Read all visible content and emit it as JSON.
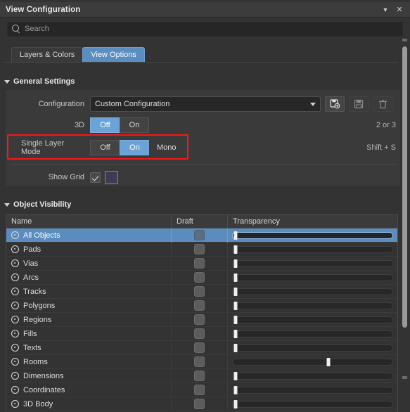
{
  "window": {
    "title": "View Configuration",
    "menu_icon": "chevron-down-icon",
    "close_icon": "close-icon"
  },
  "search": {
    "placeholder": "Search",
    "value": "",
    "icon": "search-icon"
  },
  "tabs": [
    {
      "label": "Layers & Colors",
      "active": false
    },
    {
      "label": "View Options",
      "active": true
    }
  ],
  "general_settings": {
    "header": "General Settings",
    "configuration": {
      "label": "Configuration",
      "value": "Custom Configuration",
      "buttons": [
        {
          "name": "add-configuration-button",
          "icon": "save-as-new-icon",
          "enabled": true
        },
        {
          "name": "save-configuration-button",
          "icon": "save-icon",
          "enabled": false
        },
        {
          "name": "delete-configuration-button",
          "icon": "trash-icon",
          "enabled": false
        }
      ]
    },
    "three_d": {
      "label": "3D",
      "options": [
        "Off",
        "On"
      ],
      "selected": "Off",
      "shortcut": "2 or 3"
    },
    "single_layer_mode": {
      "label": "Single Layer Mode",
      "options": [
        "Off",
        "On",
        "Mono"
      ],
      "selected": "On",
      "shortcut": "Shift + S",
      "highlighted": true
    },
    "show_grid": {
      "label": "Show Grid",
      "checked": true,
      "color": "#3f3a55"
    }
  },
  "object_visibility": {
    "header": "Object Visibility",
    "columns": [
      "Name",
      "Draft",
      "Transparency"
    ],
    "rows": [
      {
        "name": "All Objects",
        "visible": true,
        "draft": false,
        "transparency": 2,
        "selected": true
      },
      {
        "name": "Pads",
        "visible": true,
        "draft": false,
        "transparency": 2,
        "selected": false
      },
      {
        "name": "Vias",
        "visible": true,
        "draft": false,
        "transparency": 2,
        "selected": false
      },
      {
        "name": "Arcs",
        "visible": true,
        "draft": false,
        "transparency": 2,
        "selected": false
      },
      {
        "name": "Tracks",
        "visible": true,
        "draft": false,
        "transparency": 2,
        "selected": false
      },
      {
        "name": "Polygons",
        "visible": true,
        "draft": false,
        "transparency": 2,
        "selected": false
      },
      {
        "name": "Regions",
        "visible": true,
        "draft": false,
        "transparency": 2,
        "selected": false
      },
      {
        "name": "Fills",
        "visible": true,
        "draft": false,
        "transparency": 2,
        "selected": false
      },
      {
        "name": "Texts",
        "visible": true,
        "draft": false,
        "transparency": 2,
        "selected": false
      },
      {
        "name": "Rooms",
        "visible": true,
        "draft": false,
        "transparency": 60,
        "selected": false
      },
      {
        "name": "Dimensions",
        "visible": true,
        "draft": false,
        "transparency": 2,
        "selected": false
      },
      {
        "name": "Coordinates",
        "visible": true,
        "draft": false,
        "transparency": 2,
        "selected": false
      },
      {
        "name": "3D Body",
        "visible": true,
        "draft": false,
        "transparency": 2,
        "selected": false
      }
    ]
  },
  "theme": {
    "accent": "#5b8dc0",
    "highlight_red": "#f51818",
    "panel_bg": "#3a3a3a",
    "window_bg": "#333333"
  }
}
